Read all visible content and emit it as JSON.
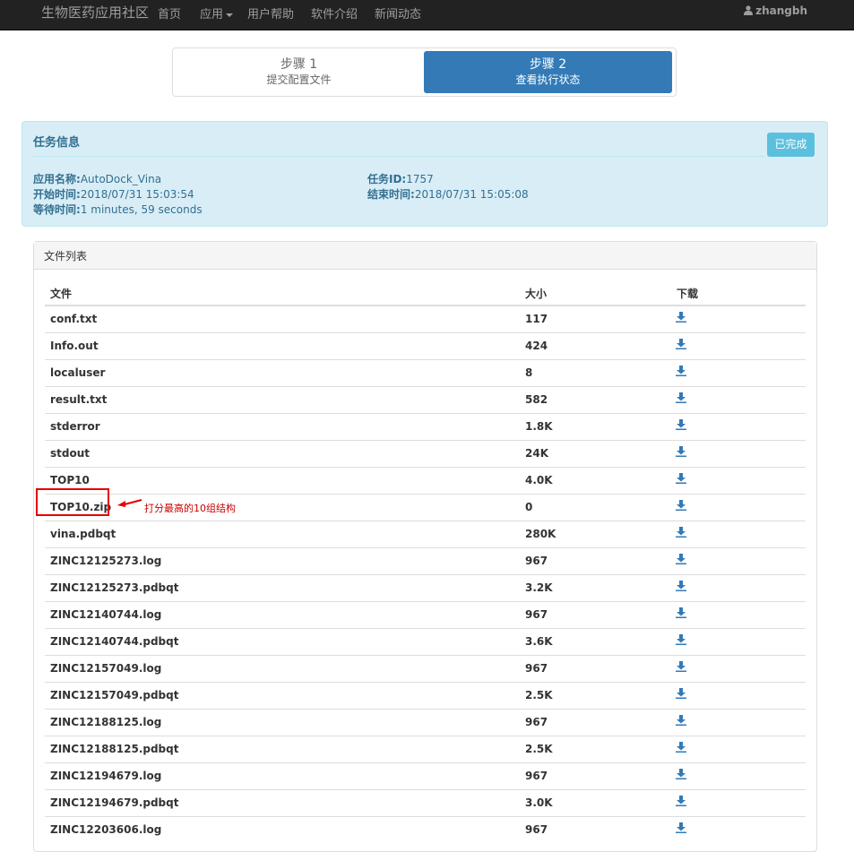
{
  "navbar": {
    "brand": "生物医药应用社区",
    "items": [
      "首页",
      "应用",
      "用户帮助",
      "软件介绍",
      "新闻动态"
    ],
    "user": "zhangbh"
  },
  "steps": [
    {
      "title": "步骤 1",
      "subtitle": "提交配置文件"
    },
    {
      "title": "步骤 2",
      "subtitle": "查看执行状态"
    }
  ],
  "task": {
    "title": "任务信息",
    "status": "已完成",
    "fields": {
      "app_name_label": "应用名称:",
      "app_name": "AutoDock_Vina",
      "task_id_label": "任务ID:",
      "task_id": "1757",
      "start_label": "开始时间:",
      "start": "2018/07/31 15:03:54",
      "end_label": "结束时间:",
      "end": "2018/07/31 15:05:08",
      "wait_label": "等待时间:",
      "wait": "1 minutes, 59 seconds"
    }
  },
  "files": {
    "panel_title": "文件列表",
    "columns": [
      "文件",
      "大小",
      "下载"
    ],
    "rows": [
      {
        "name": "conf.txt",
        "size": "117"
      },
      {
        "name": "Info.out",
        "size": "424"
      },
      {
        "name": "localuser",
        "size": "8"
      },
      {
        "name": "result.txt",
        "size": "582"
      },
      {
        "name": "stderror",
        "size": "1.8K"
      },
      {
        "name": "stdout",
        "size": "24K"
      },
      {
        "name": "TOP10",
        "size": "4.0K"
      },
      {
        "name": "TOP10.zip",
        "size": "0"
      },
      {
        "name": "vina.pdbqt",
        "size": "280K"
      },
      {
        "name": "ZINC12125273.log",
        "size": "967"
      },
      {
        "name": "ZINC12125273.pdbqt",
        "size": "3.2K"
      },
      {
        "name": "ZINC12140744.log",
        "size": "967"
      },
      {
        "name": "ZINC12140744.pdbqt",
        "size": "3.6K"
      },
      {
        "name": "ZINC12157049.log",
        "size": "967"
      },
      {
        "name": "ZINC12157049.pdbqt",
        "size": "2.5K"
      },
      {
        "name": "ZINC12188125.log",
        "size": "967"
      },
      {
        "name": "ZINC12188125.pdbqt",
        "size": "2.5K"
      },
      {
        "name": "ZINC12194679.log",
        "size": "967"
      },
      {
        "name": "ZINC12194679.pdbqt",
        "size": "3.0K"
      },
      {
        "name": "ZINC12203606.log",
        "size": "967"
      }
    ]
  },
  "annotation": {
    "text": "打分最高的10组结构"
  },
  "colors": {
    "primary": "#337ab7",
    "info_bg": "#d9edf7",
    "info_text": "#31708f",
    "badge": "#5bc0de",
    "annotation": "#e50000"
  },
  "icons": {
    "download": "download-icon",
    "user": "user-icon"
  }
}
